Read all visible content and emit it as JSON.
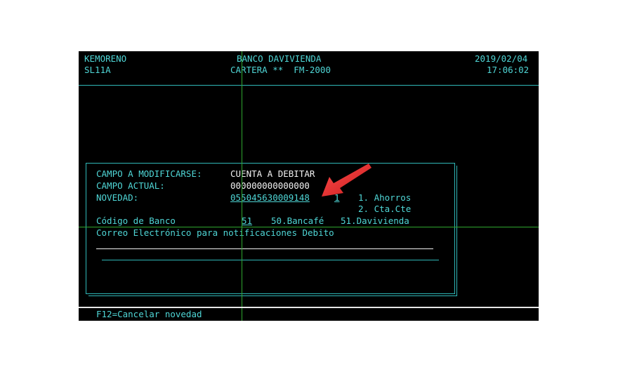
{
  "header": {
    "user": "KEMORENO",
    "bank": "BANCO DAVIVIENDA",
    "date": "2019/02/04",
    "program": "SL11A",
    "module": "CARTERA **  FM-2000",
    "time": "17:06:02"
  },
  "form": {
    "campo_modificarse_label": "CAMPO A MODIFICARSE:",
    "campo_modificarse_value": "CUENTA A DEBITAR",
    "campo_actual_label": "CAMPO ACTUAL:",
    "campo_actual_value": "000000000000000",
    "novedad_label": "NOVEDAD:",
    "novedad_value": "055045630009148",
    "tipo_value": "1",
    "option_1": "1. Ahorros",
    "option_2": "2. Cta.Cte",
    "codigo_banco_label": "Código de Banco",
    "codigo_banco_value": "51",
    "bank_option_50": "50.Bancafé",
    "bank_option_51": "51.Davivienda",
    "correo_label": "Correo Electrónico para notificaciones Debito"
  },
  "footer": {
    "f12": "F12=Cancelar novedad"
  },
  "colors": {
    "terminal_bg": "#000000",
    "text_cyan": "#4fd6d6",
    "text_white": "#f2f2f2",
    "crosshair": "#2fa82f",
    "arrow": "#e83030"
  }
}
